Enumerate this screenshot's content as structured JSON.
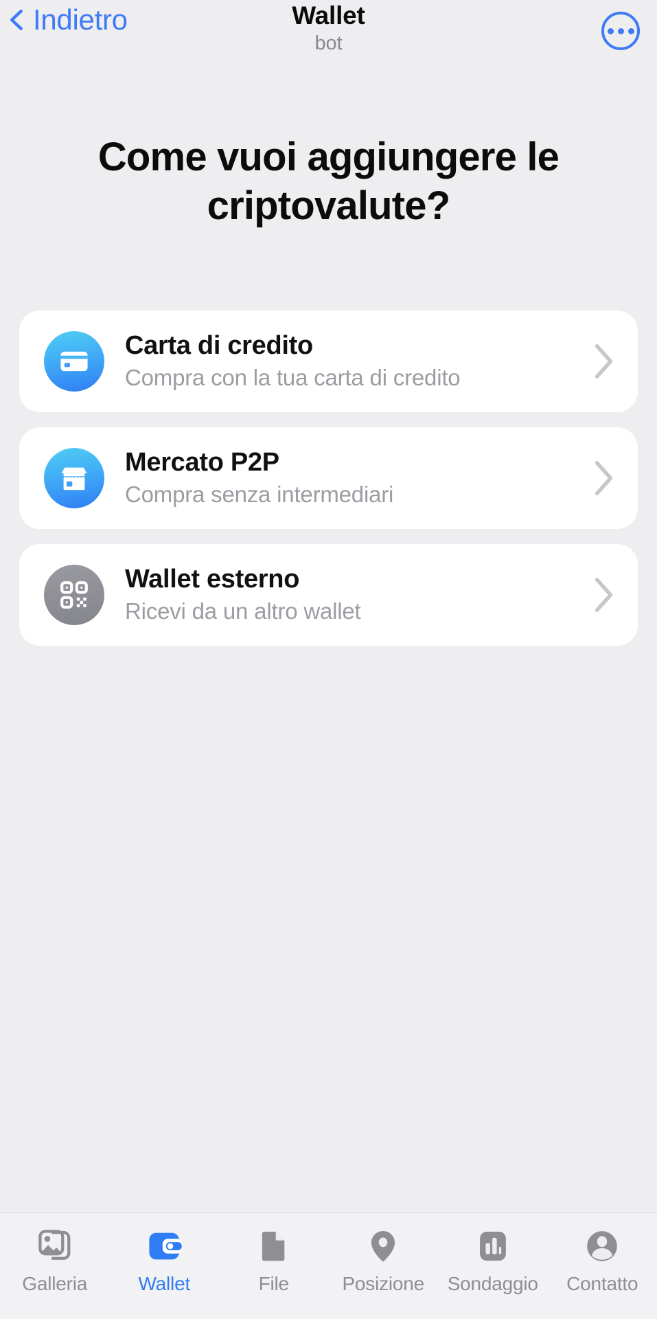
{
  "navbar": {
    "back_label": "Indietro",
    "back_icon": "chevron-left-icon",
    "title": "Wallet",
    "subtitle": "bot",
    "more_icon": "more-circle-icon"
  },
  "main": {
    "headline": "Come vuoi aggiungere le criptovalute?",
    "options": [
      {
        "icon": "credit-card-icon",
        "icon_style": "blue",
        "title": "Carta di credito",
        "subtitle": "Compra con la tua carta di credito",
        "chevron": "chevron-right-icon"
      },
      {
        "icon": "storefront-icon",
        "icon_style": "blue",
        "title": "Mercato P2P",
        "subtitle": "Compra senza intermediari",
        "chevron": "chevron-right-icon"
      },
      {
        "icon": "qr-code-icon",
        "icon_style": "grey",
        "title": "Wallet esterno",
        "subtitle": "Ricevi da un altro wallet",
        "chevron": "chevron-right-icon"
      }
    ]
  },
  "tabbar": {
    "items": [
      {
        "label": "Galleria",
        "icon": "photos-icon",
        "active": false
      },
      {
        "label": "Wallet",
        "icon": "wallet-icon",
        "active": true
      },
      {
        "label": "File",
        "icon": "file-icon",
        "active": false
      },
      {
        "label": "Posizione",
        "icon": "location-pin-icon",
        "active": false
      },
      {
        "label": "Sondaggio",
        "icon": "poll-bars-icon",
        "active": false
      },
      {
        "label": "Contatto",
        "icon": "contact-person-icon",
        "active": false
      }
    ]
  },
  "colors": {
    "accent": "#2f7df4",
    "nav_accent": "#3e7bf5",
    "background": "#eeeef0",
    "card": "#ffffff",
    "muted_text": "#9c9ca2",
    "tab_inactive": "#8e8e93"
  }
}
